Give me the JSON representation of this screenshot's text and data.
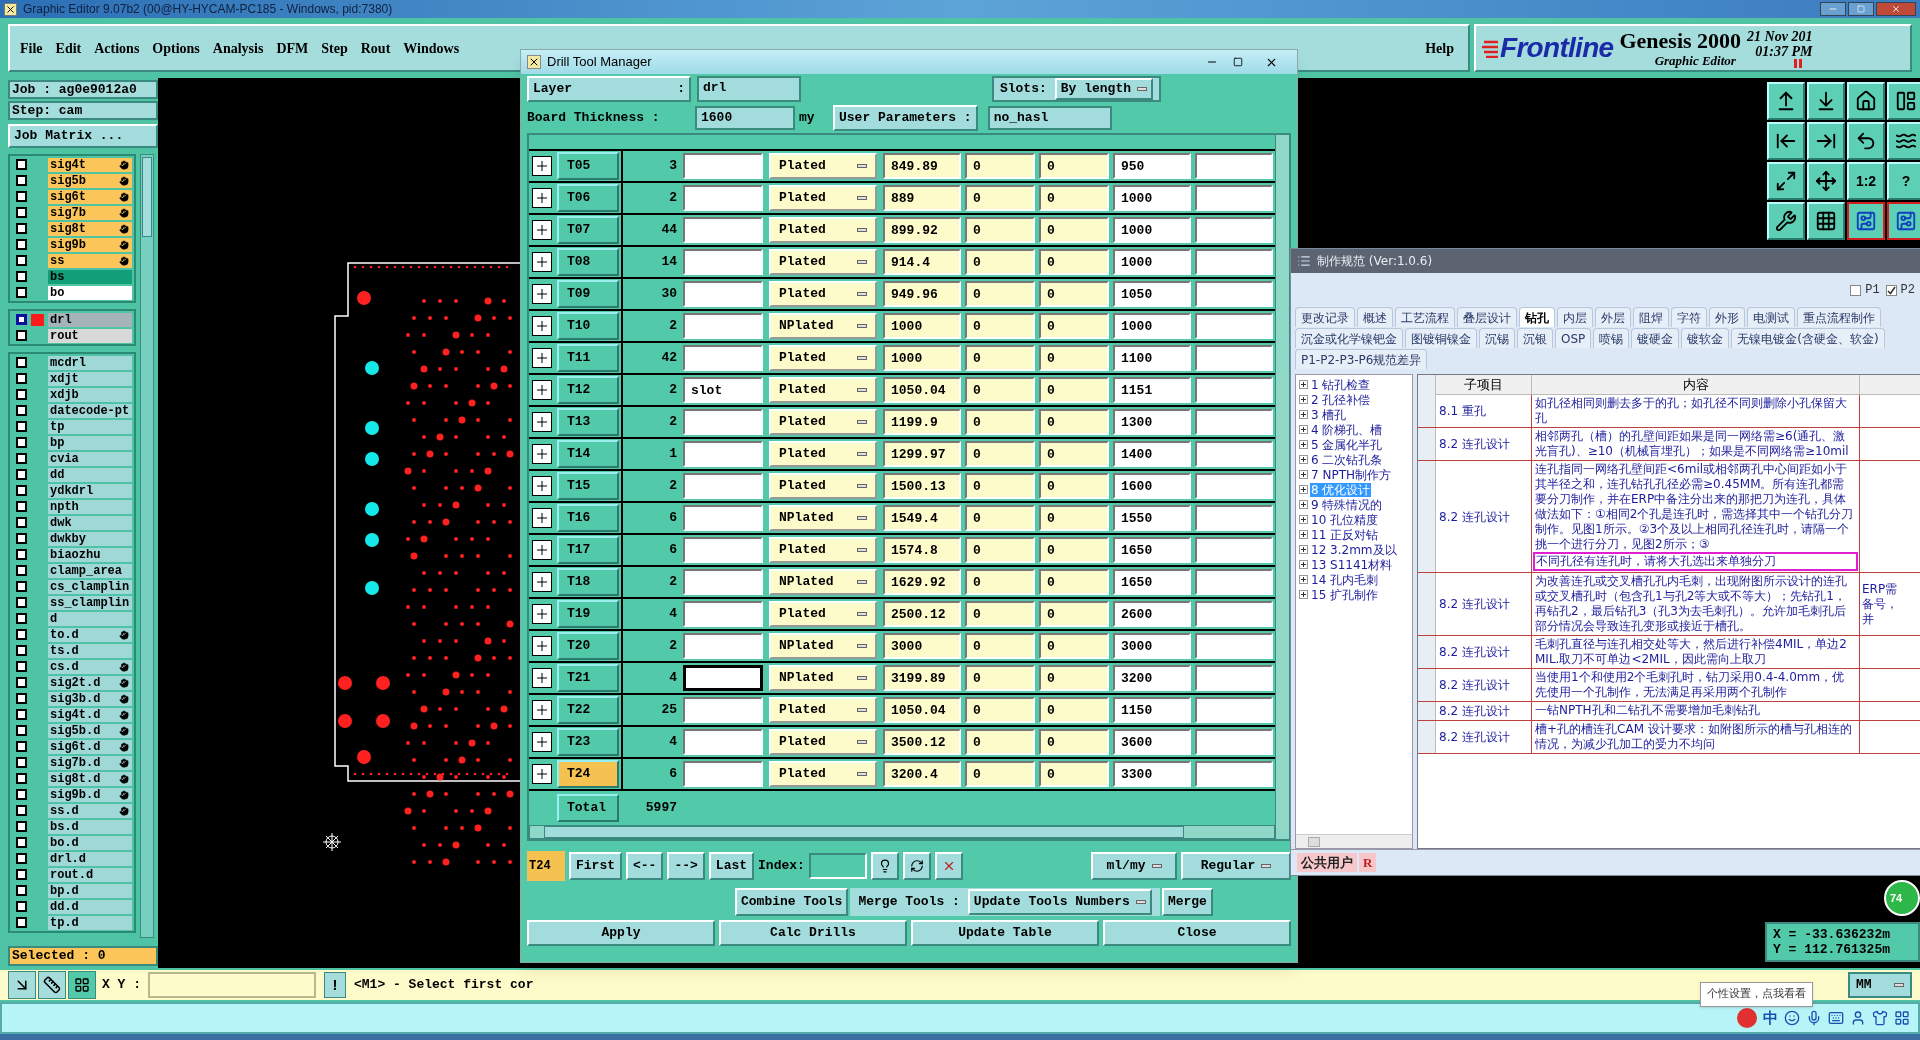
{
  "window": {
    "title": "Graphic Editor 9.07b2 (00@HY-HYCAM-PC185 - Windows, pid:7380)"
  },
  "menu": [
    "File",
    "Edit",
    "Actions",
    "Options",
    "Analysis",
    "DFM",
    "Step",
    "Rout",
    "Windows"
  ],
  "help": "Help",
  "brand": {
    "logo": "Frontline",
    "product": "Genesis 2000",
    "subtitle": "Graphic Editor",
    "date": "21 Nov 201",
    "time": "01:37 PM"
  },
  "job": {
    "job_label": "Job : ag0e9012a0",
    "step_label": "Step: cam",
    "matrix_button": "Job Matrix ...",
    "selected_count": "Selected : 0"
  },
  "layer_groups": [
    {
      "layers": [
        {
          "name": "sig4t",
          "color": "#fcc55a",
          "affected": true,
          "selected": false
        },
        {
          "name": "sig5b",
          "color": "#fcc55a",
          "affected": true,
          "selected": false
        },
        {
          "name": "sig6t",
          "color": "#fcc55a",
          "affected": true,
          "selected": false
        },
        {
          "name": "sig7b",
          "color": "#fcc55a",
          "affected": true,
          "selected": false
        },
        {
          "name": "sig8t",
          "color": "#fcc55a",
          "affected": true,
          "selected": false
        },
        {
          "name": "sig9b",
          "color": "#fcc55a",
          "affected": true,
          "selected": false
        },
        {
          "name": "ss",
          "color": "#fcc55a",
          "affected": true,
          "selected": false
        },
        {
          "name": "bs",
          "color": "#119e78",
          "affected": false,
          "selected": false
        },
        {
          "name": "bo",
          "color": "#ffffff",
          "affected": false,
          "selected": false
        }
      ]
    },
    {
      "layers": [
        {
          "name": "drl",
          "color": "#a4b4b8",
          "affected": false,
          "selected": true
        },
        {
          "name": "rout",
          "color": "#d8d8d8",
          "affected": false,
          "selected": false
        }
      ]
    },
    {
      "layers": [
        {
          "name": "mcdrl",
          "color": "#a0d8d8",
          "affected": false,
          "selected": false
        },
        {
          "name": "xdjt",
          "color": "#a0d8d8",
          "affected": false,
          "selected": false
        },
        {
          "name": "xdjb",
          "color": "#a0d8d8",
          "affected": false,
          "selected": false
        },
        {
          "name": "datecode-pt",
          "color": "#a0d8d8",
          "affected": false,
          "selected": false
        },
        {
          "name": "tp",
          "color": "#a0d8d8",
          "affected": false,
          "selected": false
        },
        {
          "name": "bp",
          "color": "#a0d8d8",
          "affected": false,
          "selected": false
        },
        {
          "name": "cvia",
          "color": "#a0d8d8",
          "affected": false,
          "selected": false
        },
        {
          "name": "dd",
          "color": "#a0d8d8",
          "affected": false,
          "selected": false
        },
        {
          "name": "ydkdrl",
          "color": "#a0d8d8",
          "affected": false,
          "selected": false
        },
        {
          "name": "npth",
          "color": "#a0d8d8",
          "affected": false,
          "selected": false
        },
        {
          "name": "dwk",
          "color": "#a0d8d8",
          "affected": false,
          "selected": false
        },
        {
          "name": "dwkby",
          "color": "#a0d8d8",
          "affected": false,
          "selected": false
        },
        {
          "name": "biaozhu",
          "color": "#a0d8d8",
          "affected": false,
          "selected": false
        },
        {
          "name": "clamp_area",
          "color": "#a0d8d8",
          "affected": false,
          "selected": false
        },
        {
          "name": "cs_clamplin",
          "color": "#a0d8d8",
          "affected": false,
          "selected": false
        },
        {
          "name": "ss_clamplin",
          "color": "#a0d8d8",
          "affected": false,
          "selected": false
        },
        {
          "name": "d",
          "color": "#a0d8d8",
          "affected": false,
          "selected": false
        },
        {
          "name": "to.d",
          "color": "#a0d8d8",
          "affected": true,
          "selected": false
        },
        {
          "name": "ts.d",
          "color": "#a0d8d8",
          "affected": false,
          "selected": false
        },
        {
          "name": "cs.d",
          "color": "#a0d8d8",
          "affected": true,
          "selected": false
        },
        {
          "name": "sig2t.d",
          "color": "#a0d8d8",
          "affected": true,
          "selected": false
        },
        {
          "name": "sig3b.d",
          "color": "#a0d8d8",
          "affected": true,
          "selected": false
        },
        {
          "name": "sig4t.d",
          "color": "#a0d8d8",
          "affected": true,
          "selected": false
        },
        {
          "name": "sig5b.d",
          "color": "#a0d8d8",
          "affected": true,
          "selected": false
        },
        {
          "name": "sig6t.d",
          "color": "#a0d8d8",
          "affected": true,
          "selected": false
        },
        {
          "name": "sig7b.d",
          "color": "#a0d8d8",
          "affected": true,
          "selected": false
        },
        {
          "name": "sig8t.d",
          "color": "#a0d8d8",
          "affected": true,
          "selected": false
        },
        {
          "name": "sig9b.d",
          "color": "#a0d8d8",
          "affected": true,
          "selected": false
        },
        {
          "name": "ss.d",
          "color": "#a0d8d8",
          "affected": true,
          "selected": false
        },
        {
          "name": "bs.d",
          "color": "#a0d8d8",
          "affected": false,
          "selected": false
        },
        {
          "name": "bo.d",
          "color": "#a0d8d8",
          "affected": false,
          "selected": false
        },
        {
          "name": "drl.d",
          "color": "#a0d8d8",
          "affected": false,
          "selected": false
        },
        {
          "name": "rout.d",
          "color": "#a0d8d8",
          "affected": false,
          "selected": false
        },
        {
          "name": "bp.d",
          "color": "#a0d8d8",
          "affected": false,
          "selected": false
        },
        {
          "name": "dd.d",
          "color": "#a0d8d8",
          "affected": false,
          "selected": false
        },
        {
          "name": "tp.d",
          "color": "#a0d8d8",
          "affected": false,
          "selected": false
        }
      ]
    }
  ],
  "view_buttons": [
    {
      "kind": "icon"
    },
    {
      "kind": "icon"
    },
    {
      "kind": "icon"
    },
    {
      "kind": "icon"
    },
    {
      "kind": "icon"
    },
    {
      "kind": "icon"
    },
    {
      "kind": "icon"
    },
    {
      "kind": "icon"
    },
    {
      "kind": "icon"
    },
    {
      "kind": "icon"
    },
    {
      "kind": "text",
      "label": "1:2"
    },
    {
      "kind": "text",
      "label": "?"
    },
    {
      "kind": "icon"
    },
    {
      "kind": "icon"
    },
    {
      "kind": "icon"
    },
    {
      "kind": "icon"
    }
  ],
  "command_bar": {
    "xy_label": "X Y :",
    "alert": "!",
    "message": "<M1> - Select first cor"
  },
  "coordinates": {
    "x": "X = -33.636232m",
    "y": "Y = 112.761325m",
    "units": "MM",
    "badge": "74"
  },
  "tooltip": "个性设置，点我看看",
  "tray": {
    "ime": "中"
  },
  "drill": {
    "title": "Drill Tool Manager",
    "layer_label": "Layer",
    "layer_colon": ":",
    "layer": "drl",
    "slots_label": "Slots:",
    "slots": "By length",
    "thickness_label": "Board Thickness :",
    "thickness": "1600",
    "thickness_unit": "my",
    "params_label": "User Parameters :",
    "params": "no_hasl",
    "rows": [
      {
        "tool": "T05",
        "count": "3",
        "type": "Plated",
        "size": "849.89",
        "col_6": "0",
        "col_7": "0",
        "finish": "950",
        "selected": false,
        "focused": false
      },
      {
        "tool": "T06",
        "count": "2",
        "type": "Plated",
        "size": "889",
        "col_6": "0",
        "col_7": "0",
        "finish": "1000",
        "selected": false,
        "focused": false
      },
      {
        "tool": "T07",
        "count": "44",
        "type": "Plated",
        "size": "899.92",
        "col_6": "0",
        "col_7": "0",
        "finish": "1000",
        "selected": false,
        "focused": false
      },
      {
        "tool": "T08",
        "count": "14",
        "type": "Plated",
        "size": "914.4",
        "col_6": "0",
        "col_7": "0",
        "finish": "1000",
        "selected": false,
        "focused": false
      },
      {
        "tool": "T09",
        "count": "30",
        "type": "Plated",
        "size": "949.96",
        "col_6": "0",
        "col_7": "0",
        "finish": "1050",
        "selected": false,
        "focused": false
      },
      {
        "tool": "T10",
        "count": "2",
        "type": "NPlated",
        "size": "1000",
        "col_6": "0",
        "col_7": "0",
        "finish": "1000",
        "selected": false,
        "focused": false
      },
      {
        "tool": "T11",
        "count": "42",
        "type": "Plated",
        "size": "1000",
        "col_6": "0",
        "col_7": "0",
        "finish": "1100",
        "selected": false,
        "focused": false
      },
      {
        "tool": "T12",
        "count": "2",
        "name": "slot",
        "type": "Plated",
        "size": "1050.04",
        "col_6": "0",
        "col_7": "0",
        "finish": "1151",
        "selected": false,
        "focused": false
      },
      {
        "tool": "T13",
        "count": "2",
        "type": "Plated",
        "size": "1199.9",
        "col_6": "0",
        "col_7": "0",
        "finish": "1300",
        "selected": false,
        "focused": false
      },
      {
        "tool": "T14",
        "count": "1",
        "type": "Plated",
        "size": "1299.97",
        "col_6": "0",
        "col_7": "0",
        "finish": "1400",
        "selected": false,
        "focused": false
      },
      {
        "tool": "T15",
        "count": "2",
        "type": "Plated",
        "size": "1500.13",
        "col_6": "0",
        "col_7": "0",
        "finish": "1600",
        "selected": false,
        "focused": false
      },
      {
        "tool": "T16",
        "count": "6",
        "type": "NPlated",
        "size": "1549.4",
        "col_6": "0",
        "col_7": "0",
        "finish": "1550",
        "selected": false,
        "focused": false
      },
      {
        "tool": "T17",
        "count": "6",
        "type": "Plated",
        "size": "1574.8",
        "col_6": "0",
        "col_7": "0",
        "finish": "1650",
        "selected": false,
        "focused": false
      },
      {
        "tool": "T18",
        "count": "2",
        "type": "NPlated",
        "size": "1629.92",
        "col_6": "0",
        "col_7": "0",
        "finish": "1650",
        "selected": false,
        "focused": false
      },
      {
        "tool": "T19",
        "count": "4",
        "type": "Plated",
        "size": "2500.12",
        "col_6": "0",
        "col_7": "0",
        "finish": "2600",
        "selected": false,
        "focused": false
      },
      {
        "tool": "T20",
        "count": "2",
        "type": "NPlated",
        "size": "3000",
        "col_6": "0",
        "col_7": "0",
        "finish": "3000",
        "selected": false,
        "focused": false
      },
      {
        "tool": "T21",
        "count": "4",
        "type": "NPlated",
        "size": "3199.89",
        "col_6": "0",
        "col_7": "0",
        "finish": "3200",
        "selected": false,
        "focused": true
      },
      {
        "tool": "T22",
        "count": "25",
        "type": "Plated",
        "size": "1050.04",
        "col_6": "0",
        "col_7": "0",
        "finish": "1150",
        "selected": false,
        "focused": false
      },
      {
        "tool": "T23",
        "count": "4",
        "type": "Plated",
        "size": "3500.12",
        "col_6": "0",
        "col_7": "0",
        "finish": "3600",
        "selected": false,
        "focused": false
      },
      {
        "tool": "T24",
        "count": "6",
        "type": "Plated",
        "size": "3200.4",
        "col_6": "0",
        "col_7": "0",
        "finish": "3300",
        "selected": true,
        "focused": false
      }
    ],
    "total_label": "Total",
    "total": "5997",
    "current": "T24",
    "nav": [
      "First",
      "<--",
      "-->",
      "Last"
    ],
    "index_label": "Index:",
    "units": "ml/my",
    "mode": "Regular",
    "combine": "Combine Tools",
    "merge_label": "Merge Tools :",
    "merge_mode": "Update Tools Numbers",
    "merge": "Merge",
    "actions": [
      "Apply",
      "Calc Drills",
      "Update Table",
      "Close"
    ]
  },
  "spec": {
    "title": "制作规范 (Ver:1.0.6)",
    "filters": [
      {
        "label": "P1",
        "checked": false
      },
      {
        "label": "P2",
        "checked": true
      }
    ],
    "tabs": [
      [
        {
          "label": "更改记录",
          "selected": false
        },
        {
          "label": "概述",
          "selected": false
        },
        {
          "label": "工艺流程",
          "selected": false
        },
        {
          "label": "叠层设计",
          "selected": false
        },
        {
          "label": "钻孔",
          "selected": true
        },
        {
          "label": "内层",
          "selected": false
        },
        {
          "label": "外层",
          "selected": false
        },
        {
          "label": "阻焊",
          "selected": false
        },
        {
          "label": "字符",
          "selected": false
        },
        {
          "label": "外形",
          "selected": false
        },
        {
          "label": "电测试",
          "selected": false
        },
        {
          "label": "重点流程制作",
          "selected": false
        }
      ],
      [
        {
          "label": "沉金或化学镍钯金",
          "selected": false
        },
        {
          "label": "图镀铜镍金",
          "selected": false
        },
        {
          "label": "沉锡",
          "selected": false
        },
        {
          "label": "沉银",
          "selected": false
        },
        {
          "label": "OSP",
          "selected": false
        },
        {
          "label": "喷锡",
          "selected": false
        },
        {
          "label": "镀硬金",
          "selected": false
        },
        {
          "label": "镀软金",
          "selected": false
        },
        {
          "label": "无镍电镀金(含硬金、软金)",
          "selected": false
        }
      ],
      [
        {
          "label": "P1-P2-P3-P6规范差异",
          "selected": false
        }
      ]
    ],
    "tree": [
      {
        "label": "1 钻孔检查",
        "selected": false
      },
      {
        "label": "2 孔径补偿",
        "selected": false
      },
      {
        "label": "3 槽孔",
        "selected": false
      },
      {
        "label": "4 阶梯孔、槽",
        "selected": false
      },
      {
        "label": "5 金属化半孔",
        "selected": false
      },
      {
        "label": "6 二次钻孔条",
        "selected": false
      },
      {
        "label": "7 NPTH制作方",
        "selected": false
      },
      {
        "label": "8 优化设计",
        "selected": true
      },
      {
        "label": "9 特殊情况的",
        "selected": false
      },
      {
        "label": "10 孔位精度",
        "selected": false
      },
      {
        "label": "11 正反对钻",
        "selected": false
      },
      {
        "label": "12 3.2mm及以",
        "selected": false
      },
      {
        "label": "13 S1141材料",
        "selected": false
      },
      {
        "label": "14 孔内毛刺",
        "selected": false
      },
      {
        "label": "15 扩孔制作",
        "selected": false
      }
    ],
    "columns": [
      "子项目",
      "内容"
    ],
    "rows": [
      {
        "item": "8.1 重孔",
        "content": "如孔径相同则删去多于的孔；如孔径不同则删除小孔保留大孔"
      },
      {
        "item": "8.2 连孔设计",
        "content": "相邻两孔（槽）的孔壁间距如果是同一网络需≥6(通孔、激光盲孔)、≥10（机械盲埋孔）；如果是不同网络需≥10mil"
      },
      {
        "item": "8.2 连孔设计",
        "content": "连孔指同一网络孔壁间距<6mil或相邻两孔中心间距如小于其半径之和，连孔钻孔孔径必需≥0.45MM。所有连孔都需要分刀制作，并在ERP中备注分出来的那把刀为连孔，具体做法如下：①相同2个孔是连孔时，需选择其中一个钻孔分刀制作。见图1所示。②3个及以上相同孔径连孔时，请隔一个挑一个进行分刀，见图2所示；③",
        "highlight": "不同孔径有连孔时，请将大孔选出来单独分刀"
      },
      {
        "item": "8.2 连孔设计",
        "content": "为改善连孔或交叉槽孔孔内毛刺，出现附图所示设计的连孔或交叉槽孔时（包含孔1与孔2等大或不等大）；先钻孔1，再钻孔2，最后钻孔3（孔3为去毛刺孔）。允许加毛刺孔后部分情况会导致连孔变形或接近于槽孔。",
        "note": "ERP需备号，并"
      },
      {
        "item": "8.2 连孔设计",
        "content": "毛刺孔直径与连孔相交处等大，然后进行补偿4MIL，单边2MIL.取刀不可单边<2MIL，因此需向上取刀"
      },
      {
        "item": "8.2 连孔设计",
        "content": "当使用1个和使用2个毛刺孔时，钻刀采用0.4-4.0mm，优先使用一个孔制作，无法满足再采用两个孔制作"
      },
      {
        "item": "8.2 连孔设计",
        "content": "一钻NPTH孔和二钻孔不需要增加毛刺钻孔"
      },
      {
        "item": "8.2 连孔设计",
        "content": "槽+孔的槽连孔CAM 设计要求：如附图所示的槽与孔相连的情况，为减少孔加工的受力不均问"
      }
    ],
    "user": "公共用户",
    "role": "R"
  }
}
